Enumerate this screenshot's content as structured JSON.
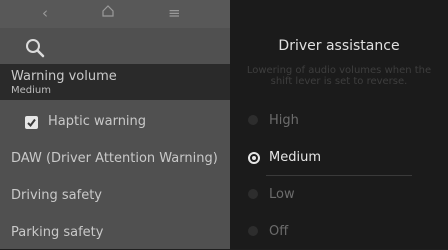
{
  "top_nav": {
    "back_icon": "chevron-left-icon",
    "home_icon": "home-icon",
    "menu_icon": "menu-icon"
  },
  "search": {
    "icon": "search-icon"
  },
  "menu": {
    "items": [
      {
        "label": "Warning volume",
        "value": "Medium"
      },
      {
        "label": "Haptic warning",
        "checked": true
      },
      {
        "label": "DAW (Driver Attention Warning)"
      },
      {
        "label": "Driving safety"
      },
      {
        "label": "Parking safety"
      }
    ]
  },
  "panel": {
    "title": "Driver assistance",
    "description": "Lowering of audio volumes when the shift lever is set to reverse.",
    "options": [
      {
        "label": "High",
        "selected": false
      },
      {
        "label": "Medium",
        "selected": true
      },
      {
        "label": "Low",
        "selected": false
      },
      {
        "label": "Off",
        "selected": false
      }
    ]
  }
}
